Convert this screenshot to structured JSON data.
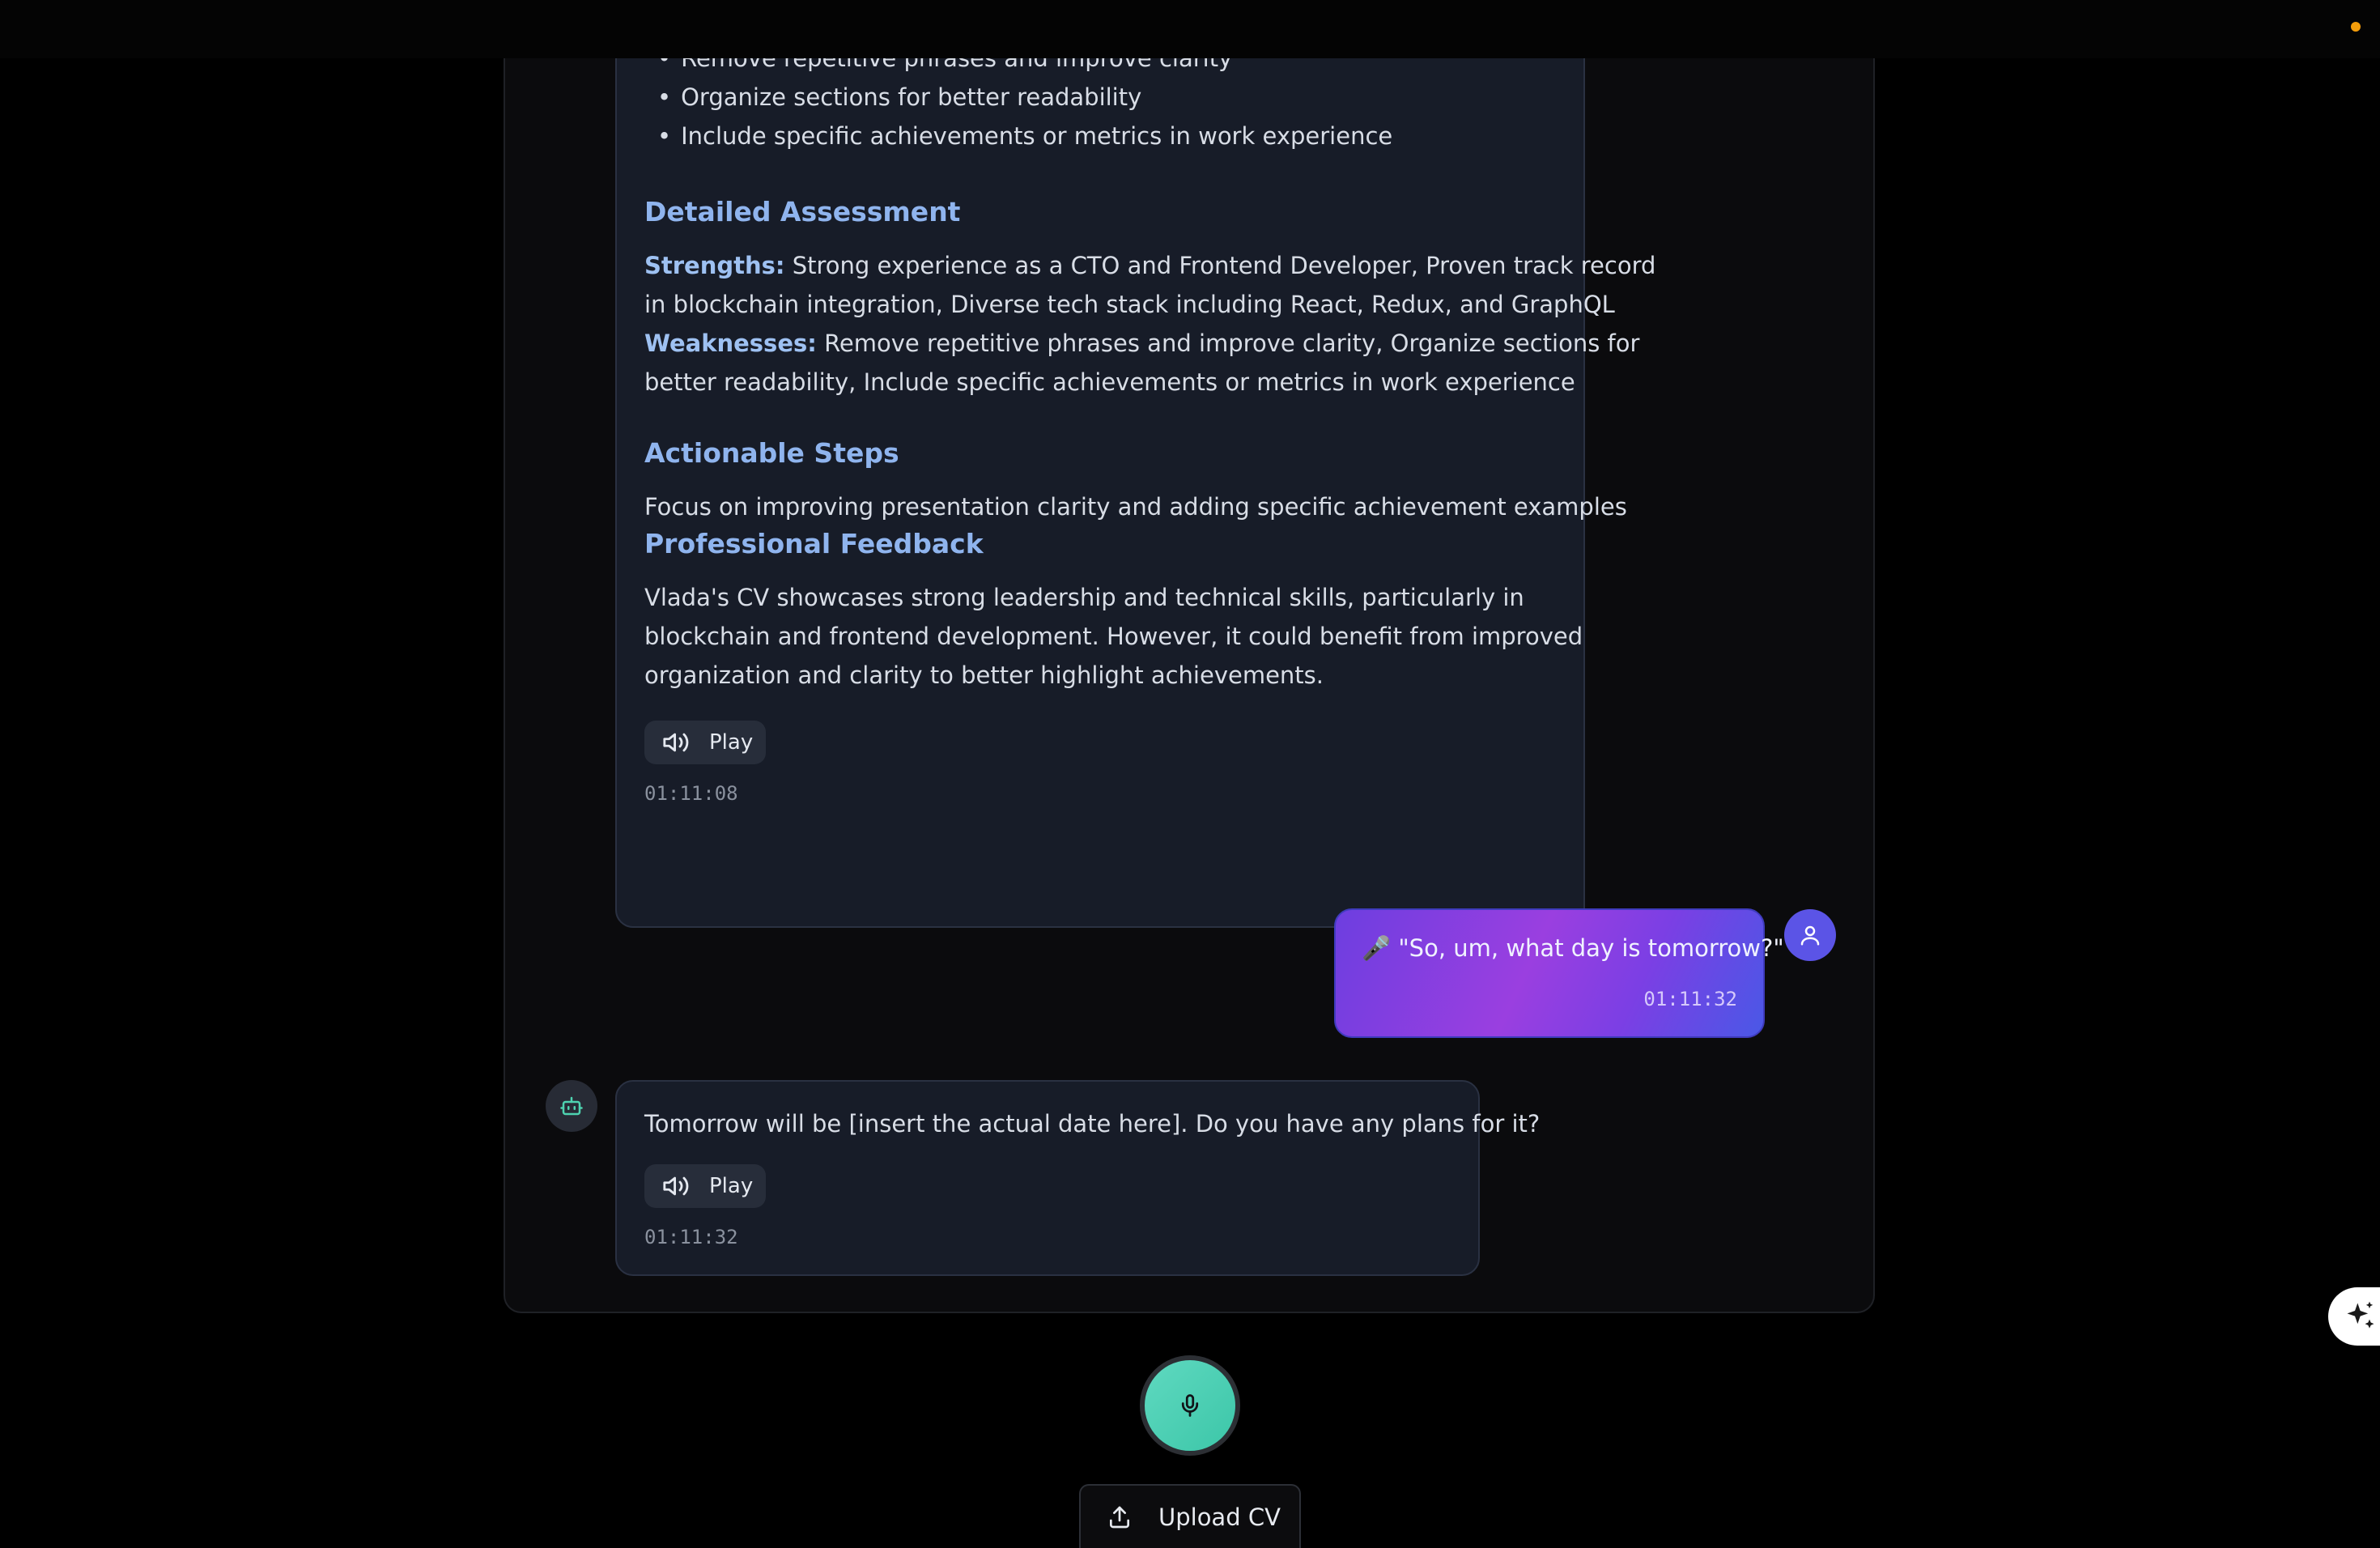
{
  "bot_message_1": {
    "bullets": [
      "Remove repetitive phrases and improve clarity",
      "Organize sections for better readability",
      "Include specific achievements or metrics in work experience"
    ],
    "detailed_heading": "Detailed Assessment",
    "strengths_label": "Strengths:",
    "strengths_line1": "Strong experience as a CTO and Frontend Developer, Proven track record",
    "strengths_line2": "in blockchain integration, Diverse tech stack including React, Redux, and GraphQL",
    "weaknesses_label": "Weaknesses:",
    "weaknesses_line1": "Remove repetitive phrases and improve clarity, Organize sections for",
    "weaknesses_line2": "better readability, Include specific achievements or metrics in work experience",
    "actionable_heading": "Actionable Steps",
    "actionable_text": "Focus on improving presentation clarity and adding specific achievement examples",
    "feedback_heading": "Professional Feedback",
    "feedback_line1": "Vlada's CV showcases strong leadership and technical skills, particularly in",
    "feedback_line2": "blockchain and frontend development. However, it could benefit from improved",
    "feedback_line3": "organization and clarity to better highlight achievements.",
    "play_label": "Play",
    "timestamp": "01:11:08"
  },
  "user_message": {
    "text": "🎤 \"So, um, what day is tomorrow?\"",
    "timestamp": "01:11:32"
  },
  "bot_message_2": {
    "text": "Tomorrow will be [insert the actual date here]. Do you have any plans for it?",
    "play_label": "Play",
    "timestamp": "01:11:32"
  },
  "controls": {
    "upload_label": "Upload CV"
  },
  "colors": {
    "heading": "#8fb4ee",
    "user_bubble_start": "#6d3ee0",
    "user_bubble_end": "#4a58e6",
    "mic_accent": "#5fd9c0",
    "status_dot": "#f59e0b"
  },
  "icons": [
    "speaker-icon",
    "user-icon",
    "bot-icon",
    "microphone-icon",
    "upload-icon",
    "sparkle-icon"
  ]
}
